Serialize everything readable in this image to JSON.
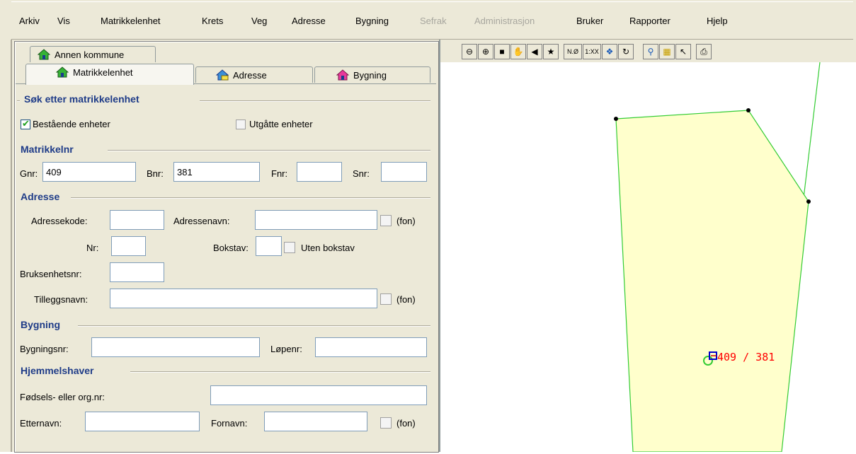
{
  "menubar": {
    "items": [
      {
        "label": "Arkiv",
        "enabled": true
      },
      {
        "label": "Vis",
        "enabled": true
      },
      {
        "label": "Matrikkelenhet",
        "enabled": true
      },
      {
        "label": "Krets",
        "enabled": true
      },
      {
        "label": "Veg",
        "enabled": true
      },
      {
        "label": "Adresse",
        "enabled": true
      },
      {
        "label": "Bygning",
        "enabled": true
      },
      {
        "label": "Sefrak",
        "enabled": false
      },
      {
        "label": "Administrasjon",
        "enabled": false
      },
      {
        "label": "Bruker",
        "enabled": true
      },
      {
        "label": "Rapporter",
        "enabled": true
      },
      {
        "label": "Hjelp",
        "enabled": true
      }
    ]
  },
  "tabs": {
    "annen_kommune": "Annen kommune",
    "matrikkelenhet": "Matrikkelenhet",
    "adresse": "Adresse",
    "bygning": "Bygning",
    "active": "Matrikkelenhet"
  },
  "form": {
    "title": "Søk etter matrikkelenhet",
    "bestaende_label": "Bestående enheter",
    "bestaende_checked": true,
    "utgatte_label": "Utgåtte enheter",
    "utgatte_checked": false,
    "matrikkelnr": {
      "heading": "Matrikkelnr",
      "gnr_label": "Gnr:",
      "gnr_value": "409",
      "bnr_label": "Bnr:",
      "bnr_value": "381",
      "fnr_label": "Fnr:",
      "fnr_value": "",
      "snr_label": "Snr:",
      "snr_value": ""
    },
    "adresse": {
      "heading": "Adresse",
      "adressekode_label": "Adressekode:",
      "adressekode_value": "",
      "adressenavn_label": "Adressenavn:",
      "adressenavn_value": "",
      "fon1_label": "(fon)",
      "nr_label": "Nr:",
      "nr_value": "",
      "bokstav_label": "Bokstav:",
      "bokstav_value": "",
      "uten_bokstav_label": "Uten bokstav",
      "bruksenhetsnr_label": "Bruksenhetsnr:",
      "bruksenhetsnr_value": "",
      "tilleggsnavn_label": "Tilleggsnavn:",
      "tilleggsnavn_value": "",
      "fon2_label": "(fon)"
    },
    "bygning": {
      "heading": "Bygning",
      "bygningsnr_label": "Bygningsnr:",
      "bygningsnr_value": "",
      "lopenr_label": "Løpenr:",
      "lopenr_value": ""
    },
    "hjemmelshaver": {
      "heading": "Hjemmelshaver",
      "fodsels_label": "Fødsels- eller org.nr:",
      "fodsels_value": "",
      "etternavn_label": "Etternavn:",
      "etternavn_value": "",
      "fornavn_label": "Fornavn:",
      "fornavn_value": "",
      "fon3_label": "(fon)"
    }
  },
  "map": {
    "toolbar_icons": [
      "zoom-out-icon",
      "zoom-in-icon",
      "zoom-window-icon",
      "pan-hand-icon",
      "previous-view-icon",
      "full-extent-icon",
      "north-arrow-icon",
      "scale-icon",
      "shrink-icon",
      "refresh-icon",
      "search-icon",
      "measure-icon",
      "select-arrow-icon",
      "print-icon"
    ],
    "parcel_label": "409 / 381",
    "parcel_fill": "#ffffcc",
    "parcel_stroke": "#33cc33",
    "label_color": "#ff0000"
  }
}
